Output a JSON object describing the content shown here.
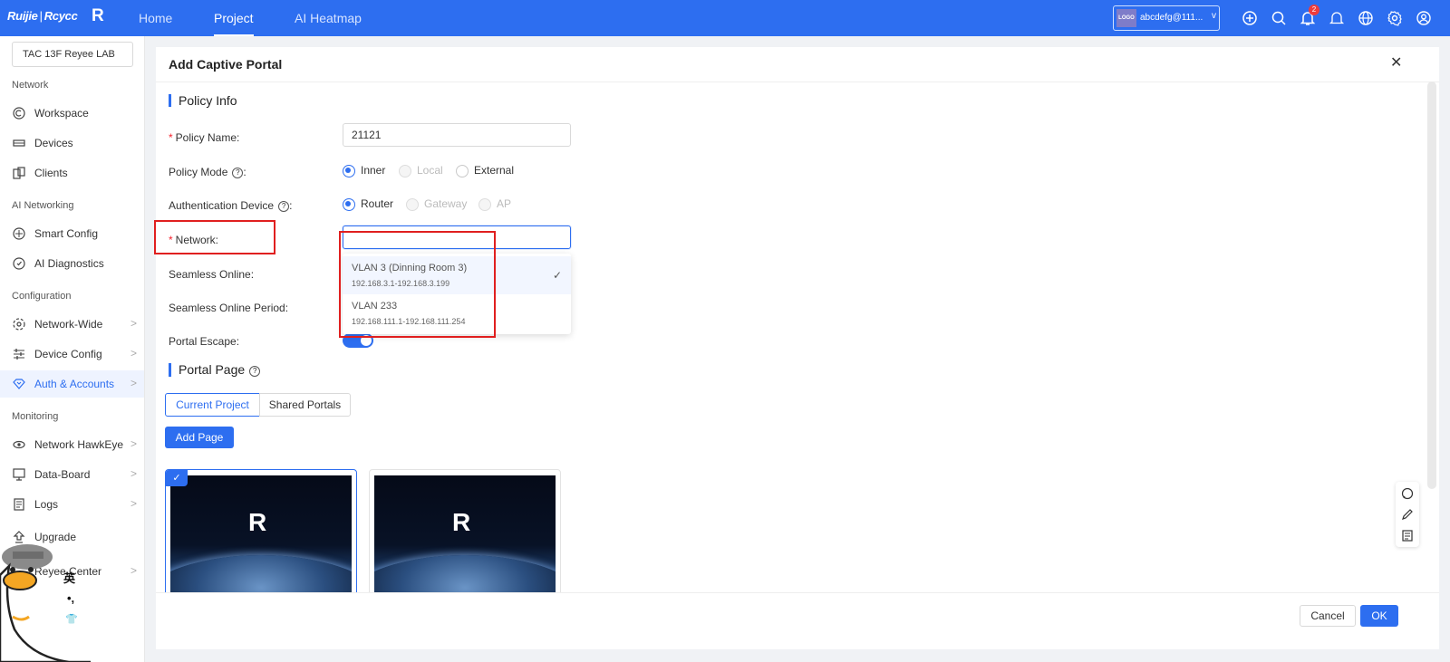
{
  "brand": {
    "name": "Ruijie",
    "separator": "|",
    "product": "Rcycc",
    "mark": "R"
  },
  "topnav": [
    {
      "label": "Home"
    },
    {
      "label": "Project"
    },
    {
      "label": "AI Heatmap"
    }
  ],
  "account": {
    "logo": "LOGO",
    "email": "abcdefg@111...",
    "caret": "v"
  },
  "notifications": {
    "count": "2"
  },
  "top_icons": [
    "add-circle-icon",
    "search-icon",
    "bell-icon",
    "bell-outline-icon",
    "globe-icon",
    "gear-icon",
    "user-icon"
  ],
  "sidebar": {
    "project": "TAC 13F Reyee LAB",
    "sections": [
      "Network",
      "AI Networking",
      "Configuration",
      "Monitoring"
    ],
    "items": [
      {
        "label": "Workspace",
        "icon": "workspace-icon"
      },
      {
        "label": "Devices",
        "icon": "devices-icon"
      },
      {
        "label": "Clients",
        "icon": "clients-icon"
      },
      {
        "label": "Smart Config",
        "icon": "smart-config-icon"
      },
      {
        "label": "AI Diagnostics",
        "icon": "ai-diagnostics-icon"
      },
      {
        "label": "Network-Wide",
        "icon": "network-wide-icon",
        "arrow": ">"
      },
      {
        "label": "Device Config",
        "icon": "device-config-icon",
        "arrow": ">"
      },
      {
        "label": "Auth & Accounts",
        "icon": "auth-icon",
        "arrow": ">",
        "active": true
      },
      {
        "label": "Network HawkEye",
        "icon": "hawkeye-icon",
        "arrow": ">"
      },
      {
        "label": "Data-Board",
        "icon": "data-board-icon",
        "arrow": ">"
      },
      {
        "label": "Logs",
        "icon": "logs-icon",
        "arrow": ">"
      },
      {
        "label": "Upgrade",
        "icon": "upgrade-icon"
      },
      {
        "label": "Reyee Center",
        "icon": "center-icon",
        "arrow": ">"
      }
    ]
  },
  "drawer": {
    "title": "Add Captive Portal",
    "close": "✕",
    "policy_info": {
      "heading": "Policy Info",
      "policy_name": {
        "label": "Policy Name:",
        "value": "21121"
      },
      "policy_mode": {
        "label": "Policy Mode",
        "colon": ":",
        "options": [
          "Inner",
          "Local",
          "External"
        ],
        "selected": "Inner"
      },
      "auth_device": {
        "label": "Authentication Device",
        "colon": ":",
        "options": [
          "Router",
          "Gateway",
          "AP"
        ],
        "selected": "Router"
      },
      "network": {
        "label": "Network:",
        "value": ""
      },
      "seamless_online": {
        "label": "Seamless Online:"
      },
      "seamless_period": {
        "label": "Seamless Online Period:"
      },
      "portal_escape": {
        "label": "Portal Escape:",
        "enabled": true
      }
    },
    "network_options": [
      {
        "name": "VLAN 3 (Dinning Room 3)",
        "range": "192.168.3.1-192.168.3.199",
        "selected": true
      },
      {
        "name": "VLAN 233",
        "range": "192.168.111.1-192.168.111.254",
        "selected": false
      }
    ],
    "portal_page": {
      "heading": "Portal Page",
      "tabs": [
        "Current Project",
        "Shared Portals"
      ],
      "active_tab": "Current Project",
      "add_button": "Add Page",
      "cards": [
        {
          "selected": true,
          "mark": "R"
        },
        {
          "selected": false,
          "mark": "R"
        }
      ]
    },
    "footer": {
      "cancel": "Cancel",
      "ok": "OK"
    }
  },
  "mascot": {
    "glyphs": [
      "英",
      "•,",
      "👕"
    ]
  },
  "colors": {
    "primary": "#2d6ef0",
    "highlight_box": "#e01f1f",
    "required": "#f5222d"
  }
}
